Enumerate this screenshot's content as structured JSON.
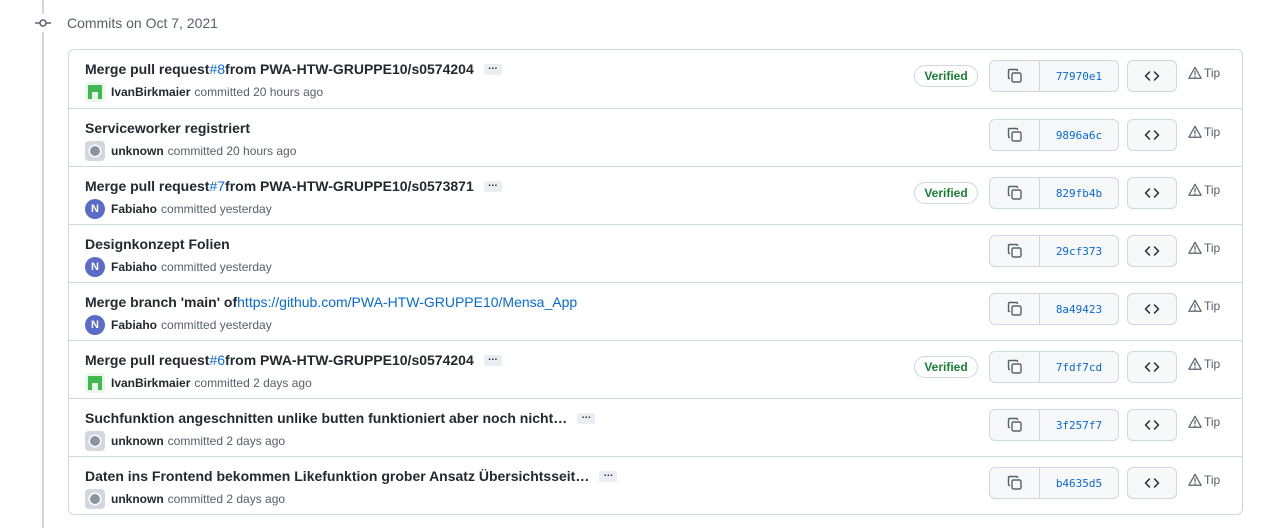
{
  "group": {
    "title": "Commits on Oct 7, 2021"
  },
  "labels": {
    "verified": "Verified",
    "tip": "Tip",
    "ellipsis": "…"
  },
  "commits": [
    {
      "title_pre": "Merge pull request ",
      "issue": "#8",
      "title_post": " from PWA-HTW-GRUPPE10/s0574204",
      "has_ellipsis": true,
      "author": "IvanBirkmaier",
      "avatar": "ivan",
      "time": "committed 20 hours ago",
      "verified": true,
      "sha": "77970e1"
    },
    {
      "title_pre": "Serviceworker registriert",
      "has_ellipsis": false,
      "author": "unknown",
      "avatar": "unknown",
      "time": "committed 20 hours ago",
      "verified": false,
      "sha": "9896a6c"
    },
    {
      "title_pre": "Merge pull request ",
      "issue": "#7",
      "title_post": " from PWA-HTW-GRUPPE10/s0573871",
      "has_ellipsis": true,
      "author": "Fabiaho",
      "avatar": "fabiaho",
      "time": "committed yesterday",
      "verified": true,
      "sha": "829fb4b"
    },
    {
      "title_pre": "Designkonzept Folien",
      "has_ellipsis": false,
      "author": "Fabiaho",
      "avatar": "fabiaho",
      "time": "committed yesterday",
      "verified": false,
      "sha": "29cf373"
    },
    {
      "title_pre": "Merge branch 'main' of ",
      "link": "https://github.com/PWA-HTW-GRUPPE10/Mensa_App",
      "has_ellipsis": false,
      "author": "Fabiaho",
      "avatar": "fabiaho",
      "time": "committed yesterday",
      "verified": false,
      "sha": "8a49423"
    },
    {
      "title_pre": "Merge pull request ",
      "issue": "#6",
      "title_post": " from PWA-HTW-GRUPPE10/s0574204",
      "has_ellipsis": true,
      "author": "IvanBirkmaier",
      "avatar": "ivan",
      "time": "committed 2 days ago",
      "verified": true,
      "sha": "7fdf7cd"
    },
    {
      "title_pre": "Suchfunktion angeschnitten unlike butten funktioniert aber noch nicht…",
      "has_ellipsis": true,
      "author": "unknown",
      "avatar": "unknown",
      "time": "committed 2 days ago",
      "verified": false,
      "sha": "3f257f7"
    },
    {
      "title_pre": "Daten ins Frontend bekommen Likefunktion grober Ansatz Übersichtsseit…",
      "has_ellipsis": true,
      "author": "unknown",
      "avatar": "unknown",
      "time": "committed 2 days ago",
      "verified": false,
      "sha": "b4635d5"
    }
  ],
  "colors": {
    "verified": "#1a7f37",
    "link": "#0969da",
    "border": "#d0d7de"
  },
  "icons": {
    "node": "git-commit-icon",
    "copy": "copy-icon",
    "browse": "code-icon",
    "tip": "alert-triangle-icon"
  }
}
